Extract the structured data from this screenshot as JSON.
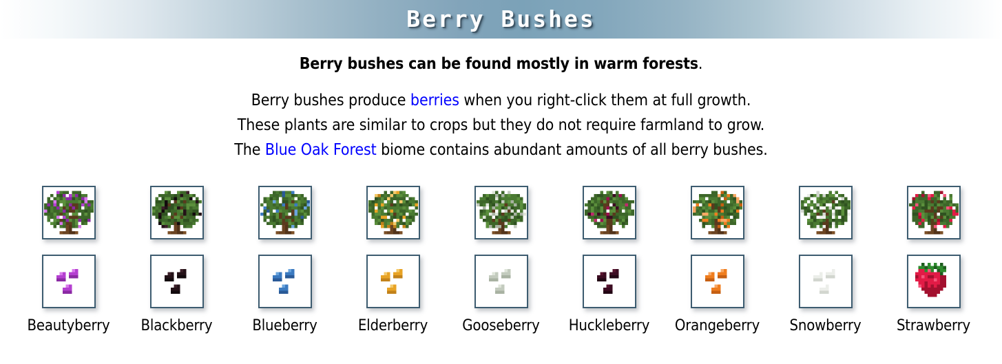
{
  "header": {
    "title": "Berry Bushes",
    "band_gradient_center_color": "#7ba2b8",
    "title_color": "#ffffff"
  },
  "intro": {
    "lead_text": "Berry bushes can be found mostly in warm forests",
    "lead_period": ".",
    "line_1": {
      "before": "Berry bushes produce ",
      "link": "berries",
      "after": " when you right-click them at full growth."
    },
    "line_2": {
      "text": "These plants are similar to crops but they do not require farmland to grow."
    },
    "line_3": {
      "before": "The ",
      "link": "Blue Oak Forest",
      "after": " biome contains abundant amounts of all berry bushes."
    },
    "link_color": "#0000ff"
  },
  "gallery": {
    "box_border_color": "#3d5c70",
    "box_background": "#ffffff",
    "leaf_colors": [
      "#4a7a32",
      "#3d6629",
      "#5b8f3c",
      "#2f5220"
    ],
    "trunk_colors": [
      "#6b4422",
      "#53341a",
      "#7d5128"
    ],
    "branch_color": "#5a3a1d",
    "items": [
      {
        "label": "Beautyberry",
        "bush_icon": "beautyberry-bush-sprite",
        "item_icon": "beautyberry-item-sprite",
        "berry_color": "#b43fd0",
        "berry_shade": "#8a2aa3",
        "berry_light": "#d878ec",
        "item_kind": "cluster"
      },
      {
        "label": "Blackberry",
        "bush_icon": "blackberry-bush-sprite",
        "item_icon": "blackberry-item-sprite",
        "berry_color": "#241218",
        "berry_shade": "#120a0d",
        "berry_light": "#3c2029",
        "item_kind": "cluster"
      },
      {
        "label": "Blueberry",
        "bush_icon": "blueberry-bush-sprite",
        "item_icon": "blueberry-item-sprite",
        "berry_color": "#3b7ac0",
        "berry_shade": "#2a5a97",
        "berry_light": "#6aa4de",
        "item_kind": "cluster"
      },
      {
        "label": "Elderberry",
        "bush_icon": "elderberry-bush-sprite",
        "item_icon": "elderberry-item-sprite",
        "berry_color": "#e8a325",
        "berry_shade": "#c2821a",
        "berry_light": "#f4c969",
        "item_kind": "cluster"
      },
      {
        "label": "Gooseberry",
        "bush_icon": "gooseberry-bush-sprite",
        "item_icon": "gooseberry-item-sprite",
        "berry_color": "#c3cbbe",
        "berry_shade": "#a8b2a2",
        "berry_light": "#dfe5da",
        "item_kind": "cluster"
      },
      {
        "label": "Huckleberry",
        "bush_icon": "huckleberry-bush-sprite",
        "item_icon": "huckleberry-item-sprite",
        "berry_color": "#9c1050",
        "berry_shade": "#3b0c22",
        "berry_light": "#c02a6e",
        "item_berry_color": "#3c0c22",
        "item_berry_shade": "#220513",
        "item_berry_light": "#58142f",
        "item_kind": "cluster"
      },
      {
        "label": "Orangeberry",
        "bush_icon": "orangeberry-bush-sprite",
        "item_icon": "orangeberry-item-sprite",
        "berry_color": "#ef7d1e",
        "berry_shade": "#c65f12",
        "berry_light": "#f8a864",
        "item_kind": "cluster"
      },
      {
        "label": "Snowberry",
        "bush_icon": "snowberry-bush-sprite",
        "item_icon": "snowberry-item-sprite",
        "berry_color": "#eceeea",
        "berry_shade": "#d2d6cf",
        "berry_light": "#ffffff",
        "item_kind": "cluster"
      },
      {
        "label": "Strawberry",
        "bush_icon": "strawberry-bush-sprite",
        "item_icon": "strawberry-item-sprite",
        "berry_color": "#e21b46",
        "berry_shade": "#a3102f",
        "berry_light": "#f4567b",
        "item_kind": "strawberry"
      }
    ]
  }
}
